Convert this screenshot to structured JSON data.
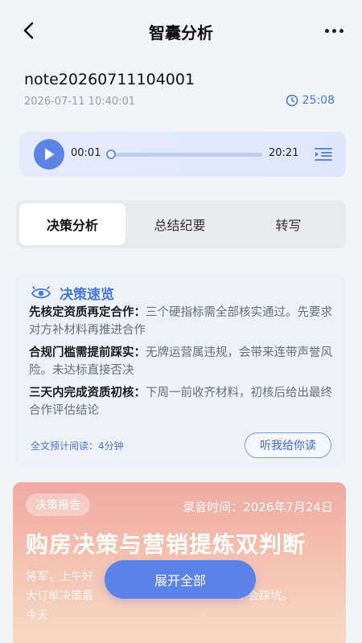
{
  "header": {
    "title": "智囊分析",
    "back_icon": "chevron-left-icon",
    "more_icon": "more-horizontal-icon"
  },
  "note": {
    "title": "note20260711104001",
    "date": "2026-07-11 10:40:01",
    "duration": "25:08"
  },
  "player": {
    "current_time": "00:01",
    "total_time": "20:21",
    "progress": 0.0,
    "accent": "#5b84e6"
  },
  "tabs": [
    {
      "label": "决策分析",
      "active": true
    },
    {
      "label": "总结纪要",
      "active": false
    },
    {
      "label": "转写",
      "active": false
    }
  ],
  "summary": {
    "title": "决策速览",
    "items": [
      {
        "head": "先核定资质再定合作：",
        "text": "三个硬指标需全部核实通过。先要求对方补材料再推进合作"
      },
      {
        "head": "合规门槛需提前踩实：",
        "text": "无牌运营属违规，会带来连带声誉风险。未达标直接否决"
      },
      {
        "head": "三天内完成资质初核：",
        "text": "下周一前收齐材料，初核后给出最终　合作评估结论"
      }
    ],
    "read_time": "全文预计阅读：4分钟",
    "listen_label": "听我给你读"
  },
  "report": {
    "tag": "决策报告",
    "record_time": "录音时间：2026年7月24日",
    "headline": "购房决策与营销提炼双判断",
    "body_lines": [
      "将军，上午好",
      "大订单决策最",
      "今天"
    ],
    "body_tail": "不会踩坑。"
  },
  "expand_label": "展开全部"
}
